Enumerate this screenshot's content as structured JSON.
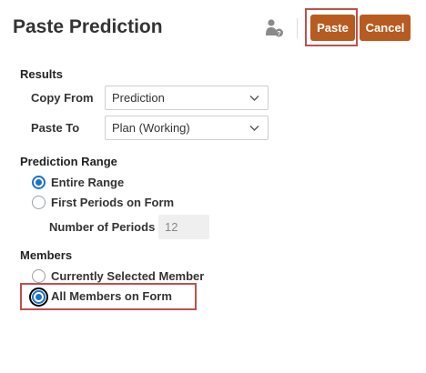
{
  "dialog": {
    "title": "Paste Prediction",
    "paste_label": "Paste",
    "cancel_label": "Cancel",
    "accent_color": "#b75b21",
    "user_icon": "user-help-icon"
  },
  "results": {
    "heading": "Results",
    "copy_from_label": "Copy From",
    "copy_from_value": "Prediction",
    "paste_to_label": "Paste To",
    "paste_to_value": "Plan (Working)"
  },
  "range": {
    "heading": "Prediction Range",
    "option_entire": "Entire Range",
    "option_first": "First Periods on Form",
    "selected": "Entire Range",
    "num_periods_label": "Number of Periods",
    "num_periods_value": "12"
  },
  "members": {
    "heading": "Members",
    "option_current": "Currently Selected Member",
    "option_all": "All Members on Form",
    "selected": "All Members on Form"
  }
}
